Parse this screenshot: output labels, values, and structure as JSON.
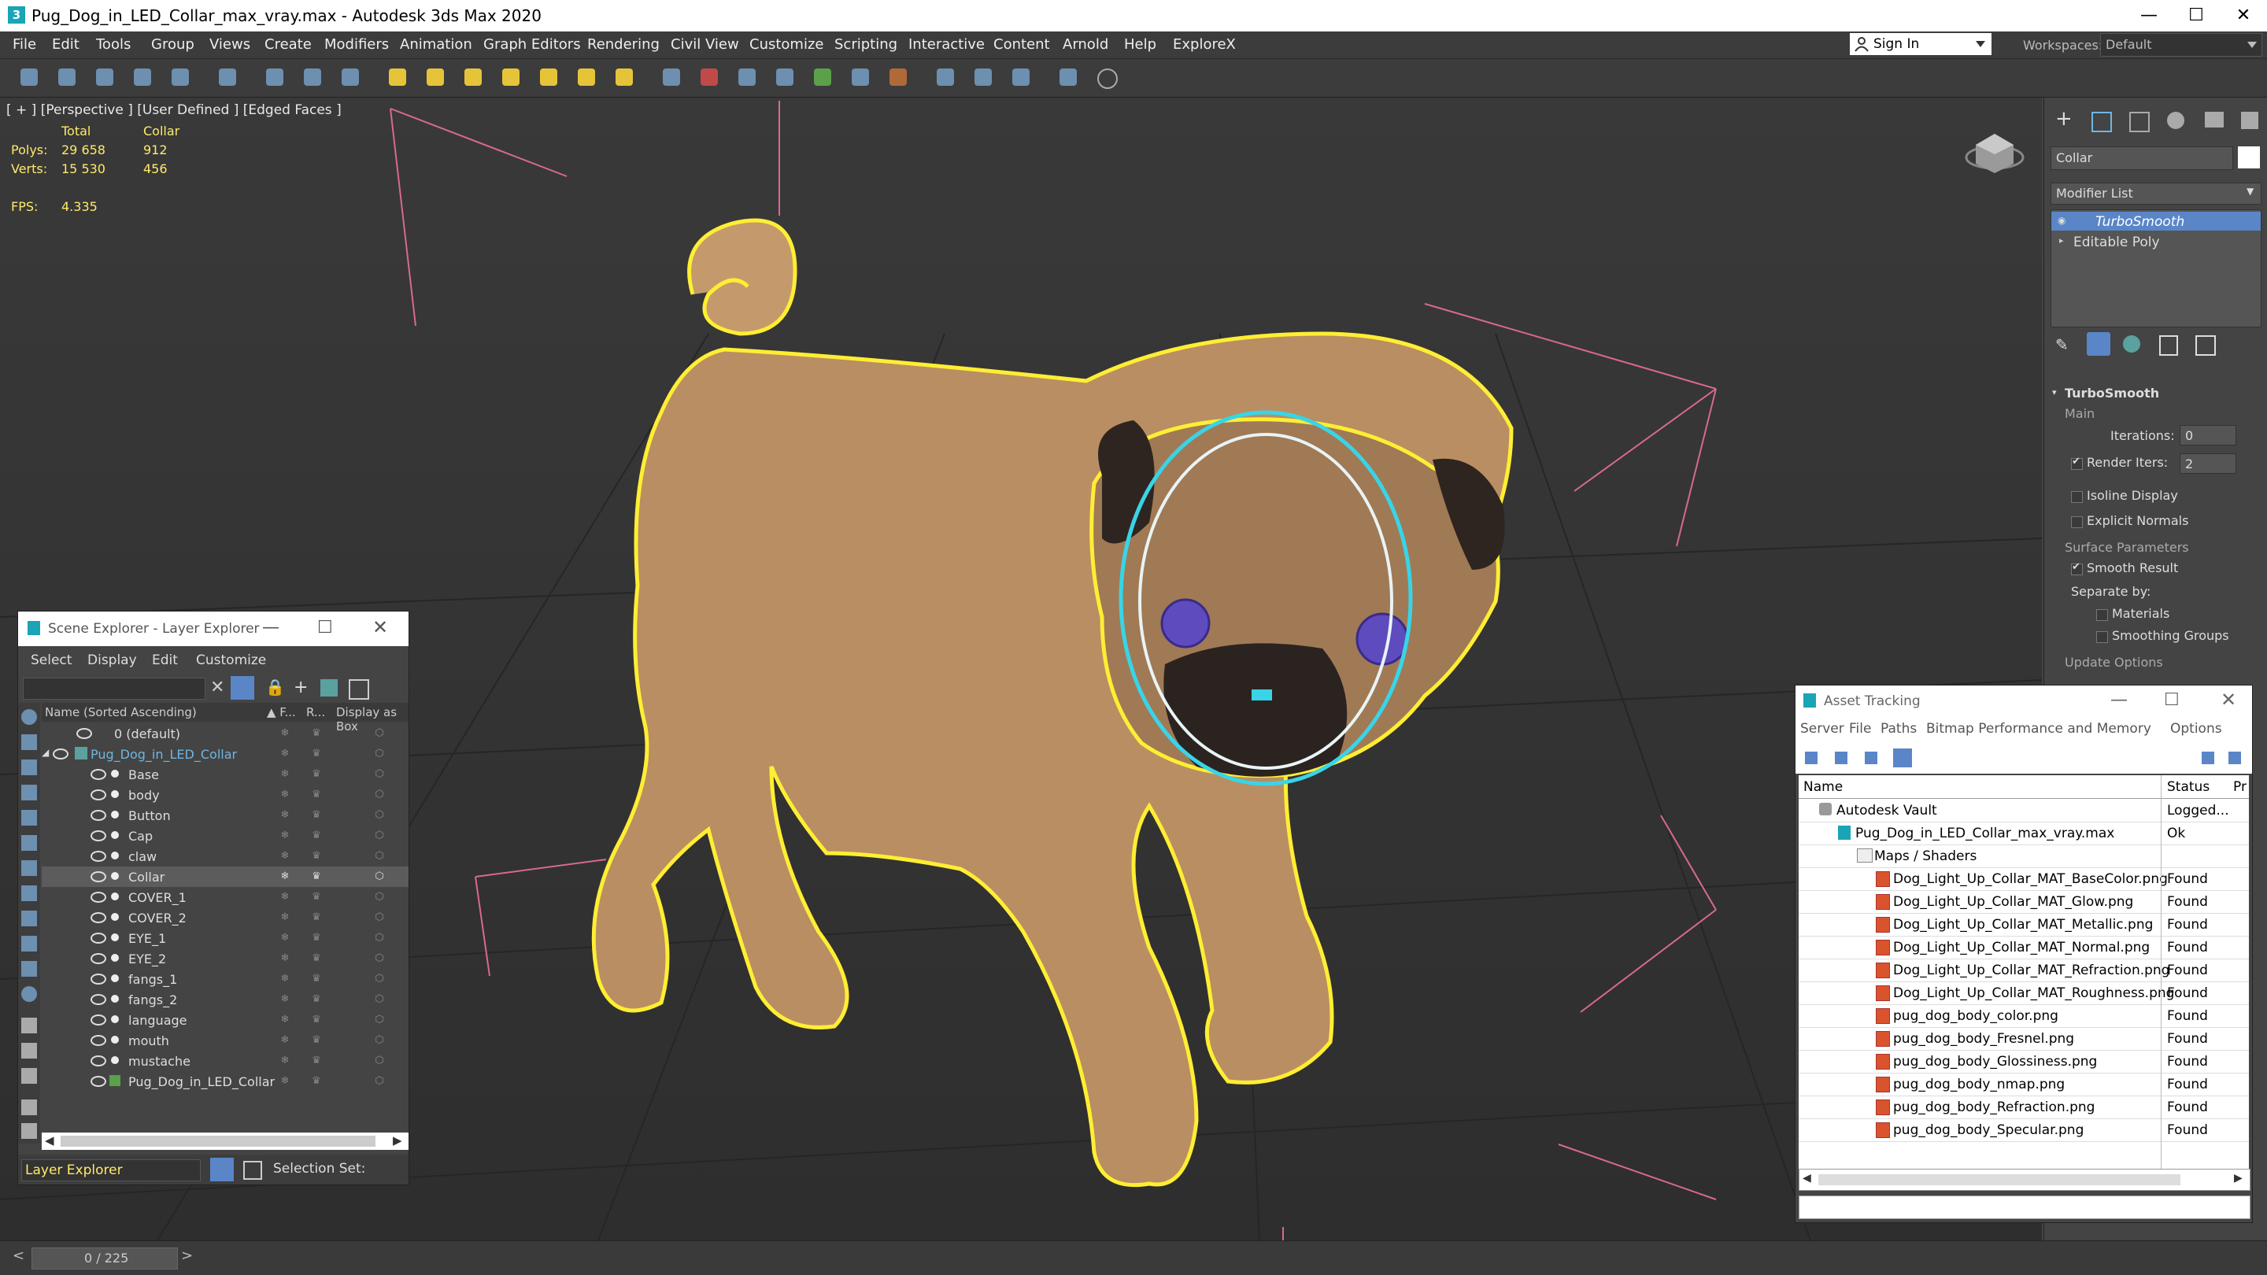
{
  "window": {
    "title": "Pug_Dog_in_LED_Collar_max_vray.max - Autodesk 3ds Max 2020",
    "app_icon": "3",
    "controls": [
      "—",
      "☐",
      "✕"
    ]
  },
  "menu": {
    "items": [
      "File",
      "Edit",
      "Tools",
      "Group",
      "Views",
      "Create",
      "Modifiers",
      "Animation",
      "Graph Editors",
      "Rendering",
      "Civil View",
      "Customize",
      "Scripting",
      "Interactive",
      "Content",
      "Arnold",
      "Help",
      "ExploreX"
    ]
  },
  "account": {
    "sign_in": "Sign In",
    "workspaces_label": "Workspaces:",
    "workspace_value": "Default"
  },
  "viewport": {
    "label": "[ + ] [Perspective ] [User Defined ] [Edged Faces ]",
    "stats": {
      "col_total": "Total",
      "col_sel": "Collar",
      "polys_label": "Polys:",
      "polys_total": "29 658",
      "polys_sel": "912",
      "verts_label": "Verts:",
      "verts_total": "15 530",
      "verts_sel": "456",
      "fps_label": "FPS:",
      "fps_value": "4.335"
    }
  },
  "command_panel": {
    "object_name": "Collar",
    "modifier_list": "Modifier List",
    "stack": [
      "TurboSmooth",
      "Editable Poly"
    ],
    "rollout_title": "TurboSmooth",
    "main_label": "Main",
    "iterations_label": "Iterations:",
    "iterations_value": "0",
    "render_iters_label": "Render Iters:",
    "render_iters_value": "2",
    "isoline": "Isoline Display",
    "explicit_normals": "Explicit Normals",
    "surface_params": "Surface Parameters",
    "smooth_result": "Smooth Result",
    "separate_by": "Separate by:",
    "materials": "Materials",
    "smoothing_groups": "Smoothing Groups",
    "update_options": "Update Options"
  },
  "scene_explorer": {
    "title": "Scene Explorer - Layer Explorer",
    "menu": [
      "Select",
      "Display",
      "Edit",
      "Customize"
    ],
    "columns": [
      "Name (Sorted Ascending)",
      "▲ F...",
      "R...",
      "Display as Box"
    ],
    "rows": [
      {
        "name": "0 (default)",
        "level": 0
      },
      {
        "name": "Pug_Dog_in_LED_Collar",
        "level": 0
      },
      {
        "name": "Base",
        "level": 1
      },
      {
        "name": "body",
        "level": 1
      },
      {
        "name": "Button",
        "level": 1
      },
      {
        "name": "Cap",
        "level": 1
      },
      {
        "name": "claw",
        "level": 1
      },
      {
        "name": "Collar",
        "level": 1
      },
      {
        "name": "COVER_1",
        "level": 1
      },
      {
        "name": "COVER_2",
        "level": 1
      },
      {
        "name": "EYE_1",
        "level": 1
      },
      {
        "name": "EYE_2",
        "level": 1
      },
      {
        "name": "fangs_1",
        "level": 1
      },
      {
        "name": "fangs_2",
        "level": 1
      },
      {
        "name": "language",
        "level": 1
      },
      {
        "name": "mouth",
        "level": 1
      },
      {
        "name": "mustache",
        "level": 1
      },
      {
        "name": "Pug_Dog_in_LED_Collar",
        "level": 1
      }
    ],
    "footer_label": "Layer Explorer",
    "selection_set": "Selection Set:"
  },
  "asset_tracking": {
    "title": "Asset Tracking",
    "menu": [
      "Server",
      "File",
      "Paths",
      "Bitmap Performance and Memory",
      "Options"
    ],
    "col_name": "Name",
    "col_status": "Status",
    "col_extra": "Pr",
    "rows": [
      {
        "name": "Autodesk Vault",
        "status": "Logged...",
        "level": 0
      },
      {
        "name": "Pug_Dog_in_LED_Collar_max_vray.max",
        "status": "Ok",
        "level": 1
      },
      {
        "name": "Maps / Shaders",
        "status": "",
        "level": 2
      },
      {
        "name": "Dog_Light_Up_Collar_MAT_BaseColor.png",
        "status": "Found",
        "level": 3
      },
      {
        "name": "Dog_Light_Up_Collar_MAT_Glow.png",
        "status": "Found",
        "level": 3
      },
      {
        "name": "Dog_Light_Up_Collar_MAT_Metallic.png",
        "status": "Found",
        "level": 3
      },
      {
        "name": "Dog_Light_Up_Collar_MAT_Normal.png",
        "status": "Found",
        "level": 3
      },
      {
        "name": "Dog_Light_Up_Collar_MAT_Refraction.png",
        "status": "Found",
        "level": 3
      },
      {
        "name": "Dog_Light_Up_Collar_MAT_Roughness.png",
        "status": "Found",
        "level": 3
      },
      {
        "name": "pug_dog_body_color.png",
        "status": "Found",
        "level": 3
      },
      {
        "name": "pug_dog_body_Fresnel.png",
        "status": "Found",
        "level": 3
      },
      {
        "name": "pug_dog_body_Glossiness.png",
        "status": "Found",
        "level": 3
      },
      {
        "name": "pug_dog_body_nmap.png",
        "status": "Found",
        "level": 3
      },
      {
        "name": "pug_dog_body_Refraction.png",
        "status": "Found",
        "level": 3
      },
      {
        "name": "pug_dog_body_Specular.png",
        "status": "Found",
        "level": 3
      }
    ]
  },
  "timeline": {
    "frame": "0 / 225"
  },
  "colors": {
    "selection_outline": "#ffee33",
    "collar_ring": "#39d4e8",
    "stats_text": "#ffea6a",
    "stack_active": "#5a86c8"
  }
}
